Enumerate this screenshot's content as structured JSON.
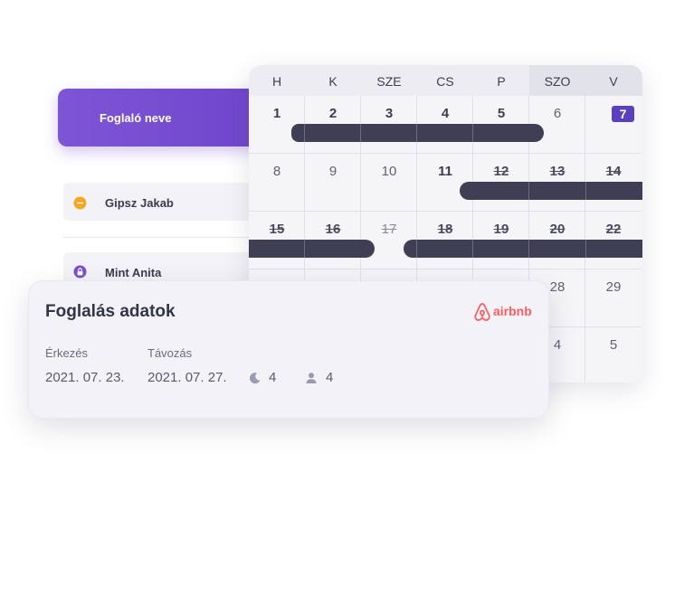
{
  "calendar": {
    "weekdays": [
      "H",
      "K",
      "SZE",
      "CS",
      "P",
      "SZO",
      "V"
    ],
    "weeks": [
      [
        "1",
        "2",
        "3",
        "4",
        "5",
        "6",
        "7"
      ],
      [
        "8",
        "9",
        "10",
        "11",
        "12",
        "13",
        "14"
      ],
      [
        "15",
        "16",
        "17",
        "18",
        "19",
        "20",
        "22"
      ],
      [
        "",
        "",
        "",
        "",
        "",
        "28",
        "29"
      ],
      [
        "",
        "",
        "",
        "",
        "",
        "4",
        "5"
      ]
    ],
    "today": "7"
  },
  "booking_list": {
    "header_label": "Foglaló neve",
    "guests": [
      {
        "name": "Gipsz Jakab",
        "icon": "minus-circle-icon",
        "color": "#f5a623"
      },
      {
        "name": "Mint Anita",
        "icon": "lock-icon",
        "color": "#7e4fd0"
      }
    ]
  },
  "details": {
    "title": "Foglalás adatok",
    "source": "airbnb",
    "arrival_label": "Érkezés",
    "arrival_value": "2021. 07. 23.",
    "departure_label": "Távozás",
    "departure_value": "2021. 07. 27.",
    "nights": "4",
    "guests": "4"
  },
  "colors": {
    "accent": "#6e46cc",
    "bar": "#3e3e54",
    "airbnb": "#ff5a5f",
    "today": "#5a3fbf"
  }
}
